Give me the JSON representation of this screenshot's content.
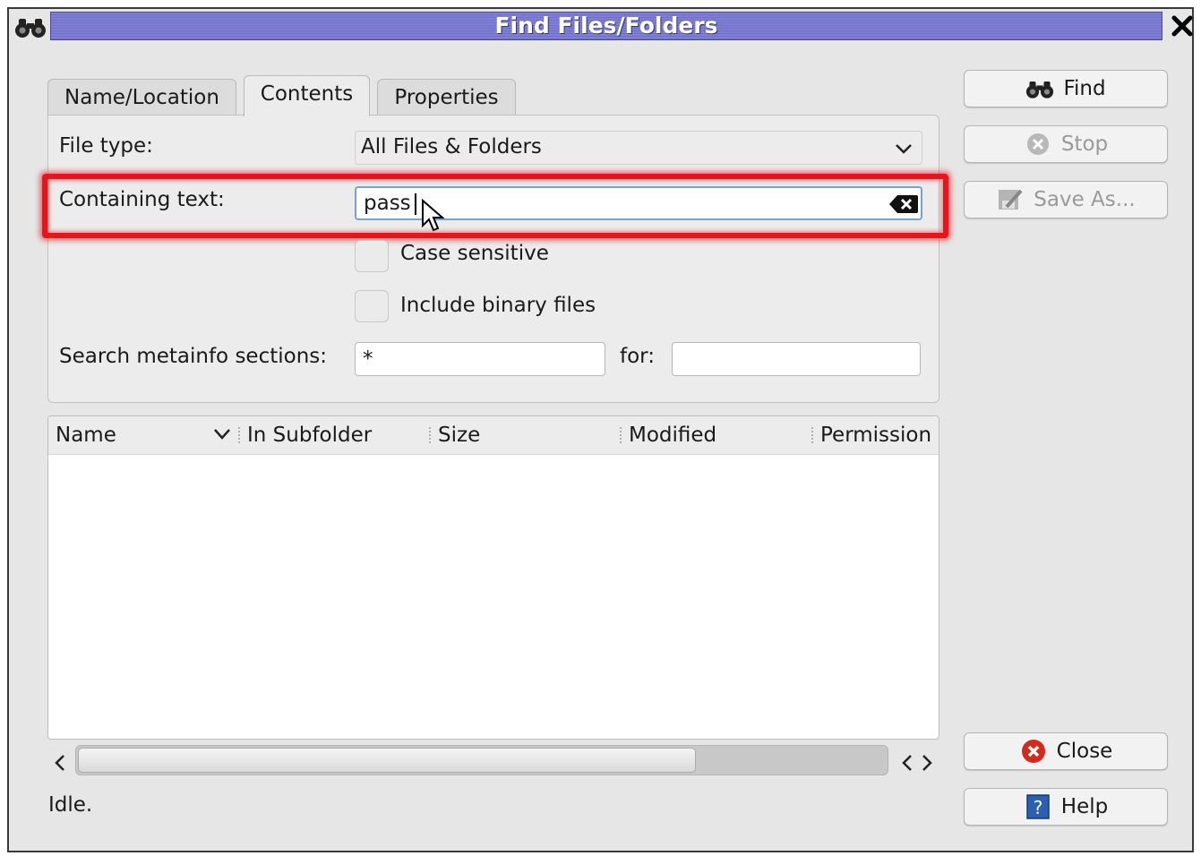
{
  "window": {
    "title": "Find Files/Folders"
  },
  "tabs": [
    {
      "label": "Name/Location",
      "active": false
    },
    {
      "label": "Contents",
      "active": true
    },
    {
      "label": "Properties",
      "active": false
    }
  ],
  "contents": {
    "file_type_label": "File type:",
    "file_type_value": "All Files & Folders",
    "containing_text_label": "Containing text:",
    "containing_text_value": "pass",
    "case_sensitive_label": "Case sensitive",
    "case_sensitive_checked": false,
    "include_binary_label": "Include binary files",
    "include_binary_checked": false,
    "metainfo_label": "Search metainfo sections:",
    "metainfo_value": "*",
    "for_label": "for:",
    "for_value": ""
  },
  "buttons": {
    "find": "Find",
    "stop": "Stop",
    "save_as": "Save As...",
    "close": "Close",
    "help": "Help"
  },
  "results": {
    "columns": [
      "Name",
      "In Subfolder",
      "Size",
      "Modified",
      "Permission"
    ],
    "rows": []
  },
  "status": "Idle.",
  "colors": {
    "title_bar": "#7f7fd4",
    "highlight": "#e8141c"
  }
}
